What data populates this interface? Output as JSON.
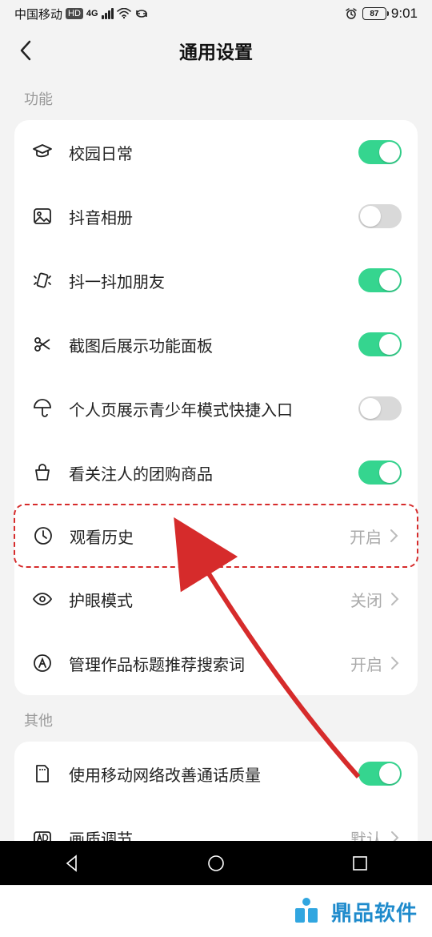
{
  "status": {
    "carrier": "中国移动",
    "net_badge": "HD",
    "net_gen": "4G",
    "battery": "87",
    "time": "9:01"
  },
  "header": {
    "title": "通用设置"
  },
  "sections": {
    "func_label": "功能",
    "other_label": "其他"
  },
  "rows": {
    "campus": {
      "label": "校园日常",
      "toggle": true
    },
    "album": {
      "label": "抖音相册",
      "toggle": false
    },
    "shake": {
      "label": "抖一抖加朋友",
      "toggle": true
    },
    "scrshot": {
      "label": "截图后展示功能面板",
      "toggle": true
    },
    "youth": {
      "label": "个人页展示青少年模式快捷入口",
      "toggle": false
    },
    "group": {
      "label": "看关注人的团购商品",
      "toggle": true
    },
    "history": {
      "label": "观看历史",
      "value": "开启"
    },
    "eye": {
      "label": "护眼模式",
      "value": "关闭"
    },
    "search": {
      "label": "管理作品标题推荐搜索词",
      "value": "开启"
    },
    "mobile": {
      "label": "使用移动网络改善通话质量",
      "toggle": true
    },
    "quality": {
      "label": "画质调节",
      "value": "默认"
    }
  },
  "annotation": {
    "highlight_row": "history"
  },
  "footer": {
    "brand": "鼎品软件"
  },
  "colors": {
    "accent": "#35d58f",
    "arrow": "#d62b2b"
  }
}
